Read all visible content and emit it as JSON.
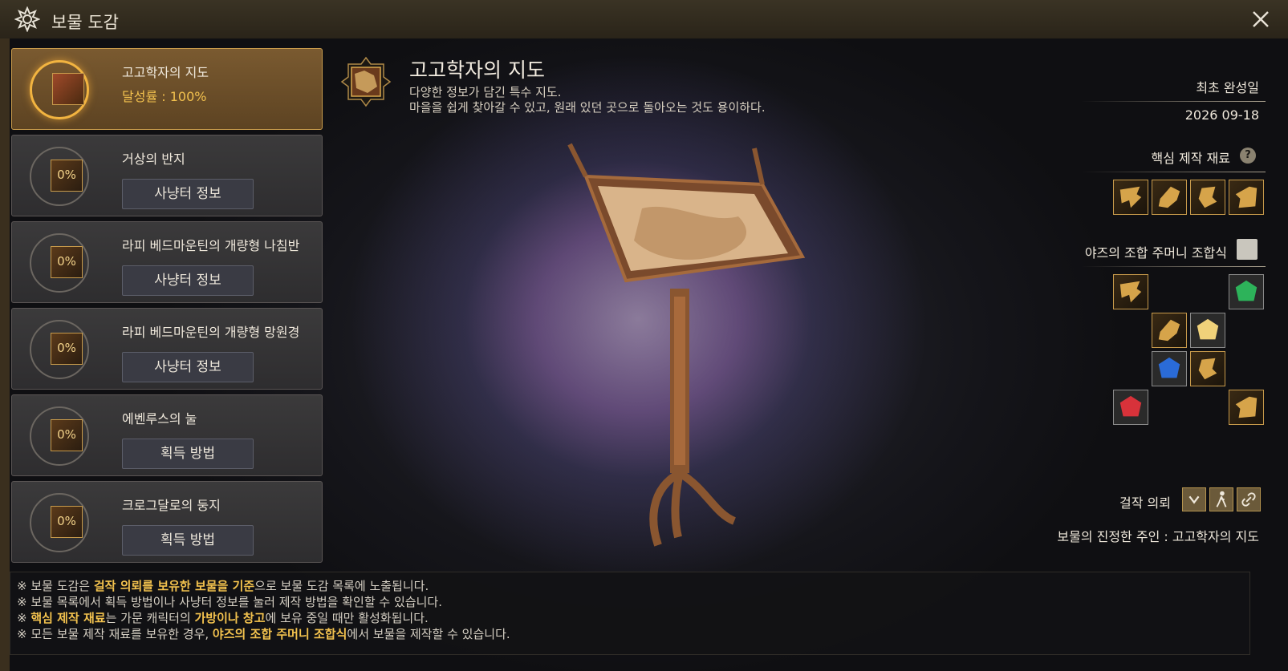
{
  "window": {
    "title": "보물 도감"
  },
  "items": [
    {
      "name": "고고학자의 지도",
      "rate": "달성률 : 100%",
      "selected": true
    },
    {
      "name": "거상의 반지",
      "pct": "0%",
      "button": "사냥터 정보"
    },
    {
      "name": "라피 베드마운틴의 개량형 나침반",
      "pct": "0%",
      "button": "사냥터 정보"
    },
    {
      "name": "라피 베드마운틴의 개량형 망원경",
      "pct": "0%",
      "button": "사냥터 정보"
    },
    {
      "name": "에벤루스의 눌",
      "pct": "0%",
      "button": "획득 방법"
    },
    {
      "name": "크로그달로의 둥지",
      "pct": "0%",
      "button": "획득 방법"
    }
  ],
  "detail": {
    "title": "고고학자의 지도",
    "desc_line1": "다양한 정보가 담긴 특수 지도.",
    "desc_line2": "마을을 쉽게 찾아갈 수 있고, 원래 있던 곳으로 돌아오는 것도 용이하다."
  },
  "right": {
    "first_completed_label": "최초 완성일",
    "first_completed_date": "2026 09-18",
    "core_materials_label": "핵심 제작 재료",
    "help_icon": "?",
    "recipe_label": "야즈의 조합 주머니 조합식",
    "masterpiece_label": "걸작 의뢰",
    "owner_text": "보물의 진정한 주인 : 고고학자의 지도"
  },
  "notes": [
    [
      "※ 보물 도감은 ",
      "걸작 의뢰를 보유한 보물을 기준",
      "으로 보물 도감 목록에 노출됩니다."
    ],
    [
      "※ 보물 목록에서 획득 방법이나 사냥터 정보를 눌러 제작 방법을 확인할 수 있습니다.",
      "",
      ""
    ],
    [
      "※ ",
      "핵심 제작 재료",
      "는 가문 캐릭터의 "
    ],
    [
      "※ 모든 보물 제작 재료를 보유한 경우, ",
      "야즈의 조합 주머니 조합식",
      "에서 보물을 제작할 수 있습니다."
    ]
  ],
  "note3_extra": {
    "hl": "가방이나 창고",
    "tail": "에 보유 중일 때만 활성화됩니다."
  },
  "colors": {
    "accent": "#f2c14e",
    "frame": "#c79a4b"
  }
}
